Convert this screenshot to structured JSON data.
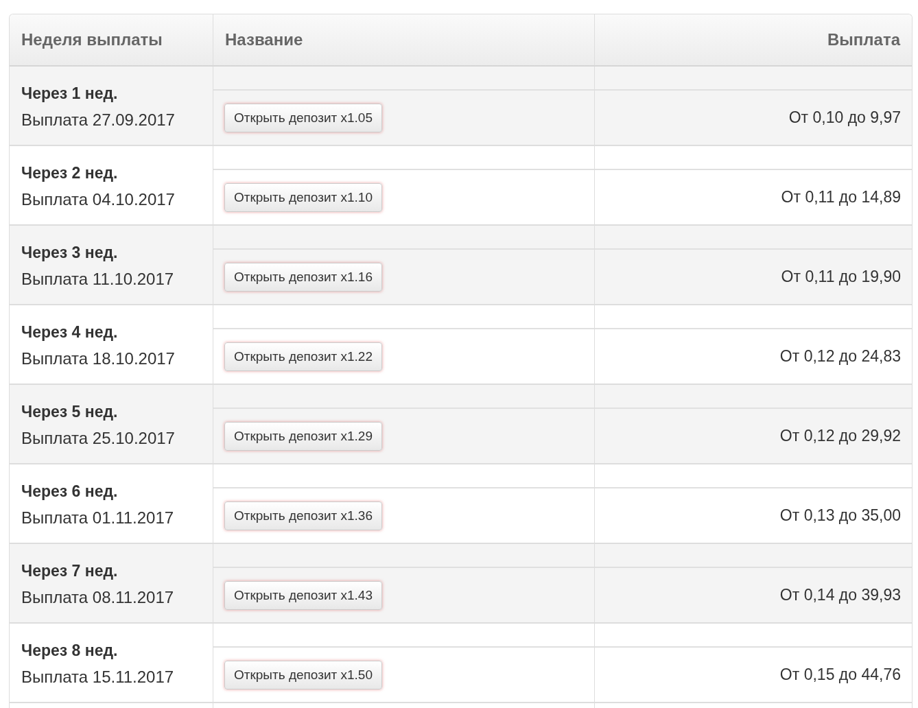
{
  "table": {
    "columns": [
      "Неделя выплаты",
      "Название",
      "Выплата"
    ],
    "rows": [
      {
        "week": "Через 1 нед.",
        "date": "Выплата 27.09.2017",
        "button": "Открыть депозит x1.05",
        "payout": "От 0,10 до 9,97"
      },
      {
        "week": "Через 2 нед.",
        "date": "Выплата 04.10.2017",
        "button": "Открыть депозит x1.10",
        "payout": "От 0,11 до 14,89"
      },
      {
        "week": "Через 3 нед.",
        "date": "Выплата 11.10.2017",
        "button": "Открыть депозит x1.16",
        "payout": "От 0,11 до 19,90"
      },
      {
        "week": "Через 4 нед.",
        "date": "Выплата 18.10.2017",
        "button": "Открыть депозит x1.22",
        "payout": "От 0,12 до 24,83"
      },
      {
        "week": "Через 5 нед.",
        "date": "Выплата 25.10.2017",
        "button": "Открыть депозит x1.29",
        "payout": "От 0,12 до 29,92"
      },
      {
        "week": "Через 6 нед.",
        "date": "Выплата 01.11.2017",
        "button": "Открыть депозит x1.36",
        "payout": "От 0,13 до 35,00"
      },
      {
        "week": "Через 7 нед.",
        "date": "Выплата 08.11.2017",
        "button": "Открыть депозит x1.43",
        "payout": "От 0,14 до 39,93"
      },
      {
        "week": "Через 8 нед.",
        "date": "Выплата 15.11.2017",
        "button": "Открыть депозит x1.50",
        "payout": "От 0,15 до 44,76"
      }
    ]
  }
}
